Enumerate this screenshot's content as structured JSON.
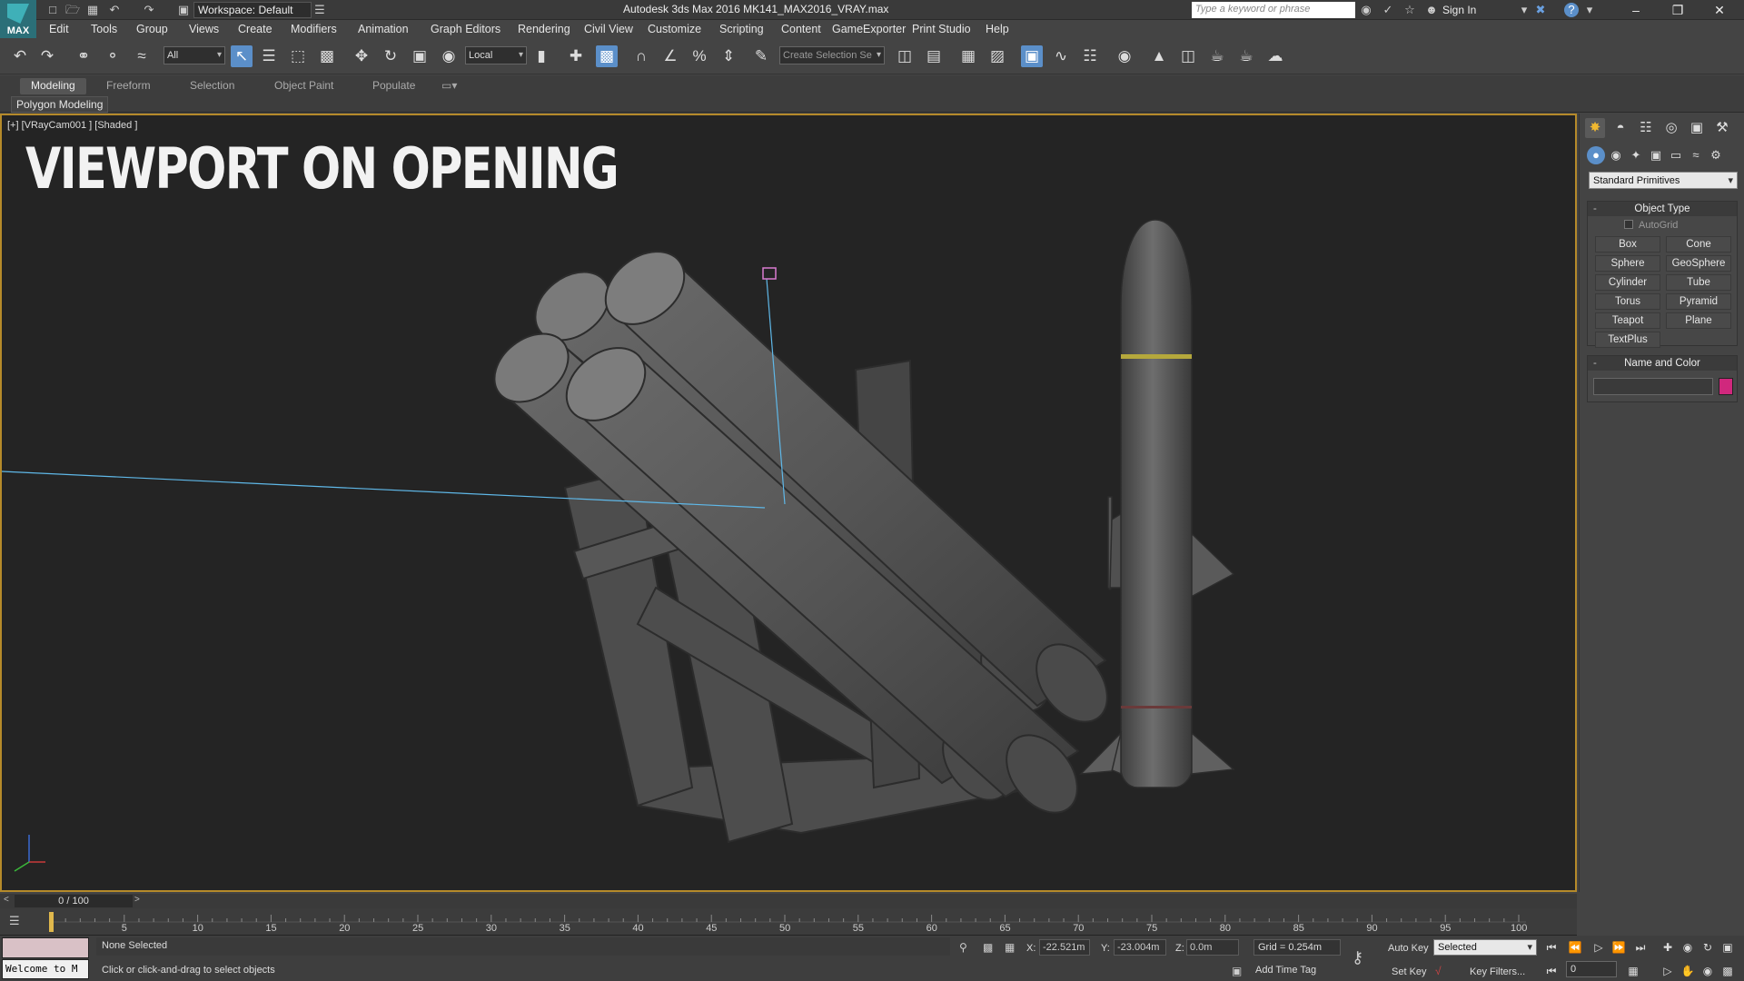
{
  "app": {
    "title": "Autodesk 3ds Max 2016    MK141_MAX2016_VRAY.max",
    "logo_label": "MAX",
    "workspace": "Workspace: Default",
    "search_placeholder": "Type a keyword or phrase",
    "sign_in": "Sign In"
  },
  "menu": [
    "Edit",
    "Tools",
    "Group",
    "Views",
    "Create",
    "Modifiers",
    "Animation",
    "Graph Editors",
    "Rendering",
    "Civil View",
    "Customize",
    "Scripting",
    "Content",
    "GameExporter",
    "Print Studio",
    "Help"
  ],
  "toolbar": {
    "selection_filter": "All",
    "ref_coord": "Local",
    "named_selection_placeholder": "Create Selection Se"
  },
  "ribbon": {
    "tabs": [
      "Modeling",
      "Freeform",
      "Selection",
      "Object Paint",
      "Populate"
    ],
    "active_tab": "Modeling",
    "panel_label": "Polygon Modeling"
  },
  "viewport": {
    "label": "[+] [VRayCam001 ] [Shaded ]",
    "caption": "VIEWPORT ON OPENING"
  },
  "command_panel": {
    "category": "Standard Primitives",
    "object_type_title": "Object Type",
    "autogrid_label": "AutoGrid",
    "primitives": [
      "Box",
      "Cone",
      "Sphere",
      "GeoSphere",
      "Cylinder",
      "Tube",
      "Torus",
      "Pyramid",
      "Teapot",
      "Plane",
      "TextPlus"
    ],
    "name_color_title": "Name and Color",
    "object_color": "#d0287d"
  },
  "timeline": {
    "frame_display": "0 / 100",
    "ticks": [
      "5",
      "10",
      "15",
      "20",
      "25",
      "30",
      "35",
      "40",
      "45",
      "50",
      "55",
      "60",
      "65",
      "70",
      "75",
      "80",
      "85",
      "90",
      "95",
      "100"
    ]
  },
  "status": {
    "maxscript_text": "Welcome to M",
    "selection": "None Selected",
    "prompt": "Click or click-and-drag to select objects",
    "x_label": "X:",
    "x_value": "-22.521m",
    "y_label": "Y:",
    "y_value": "-23.004m",
    "z_label": "Z:",
    "z_value": "0.0m",
    "grid": "Grid = 0.254m",
    "add_time_tag": "Add Time Tag",
    "auto_key": "Auto Key",
    "set_key": "Set Key",
    "key_mode": "Selected",
    "key_filters": "Key Filters...",
    "current_frame": "0"
  }
}
